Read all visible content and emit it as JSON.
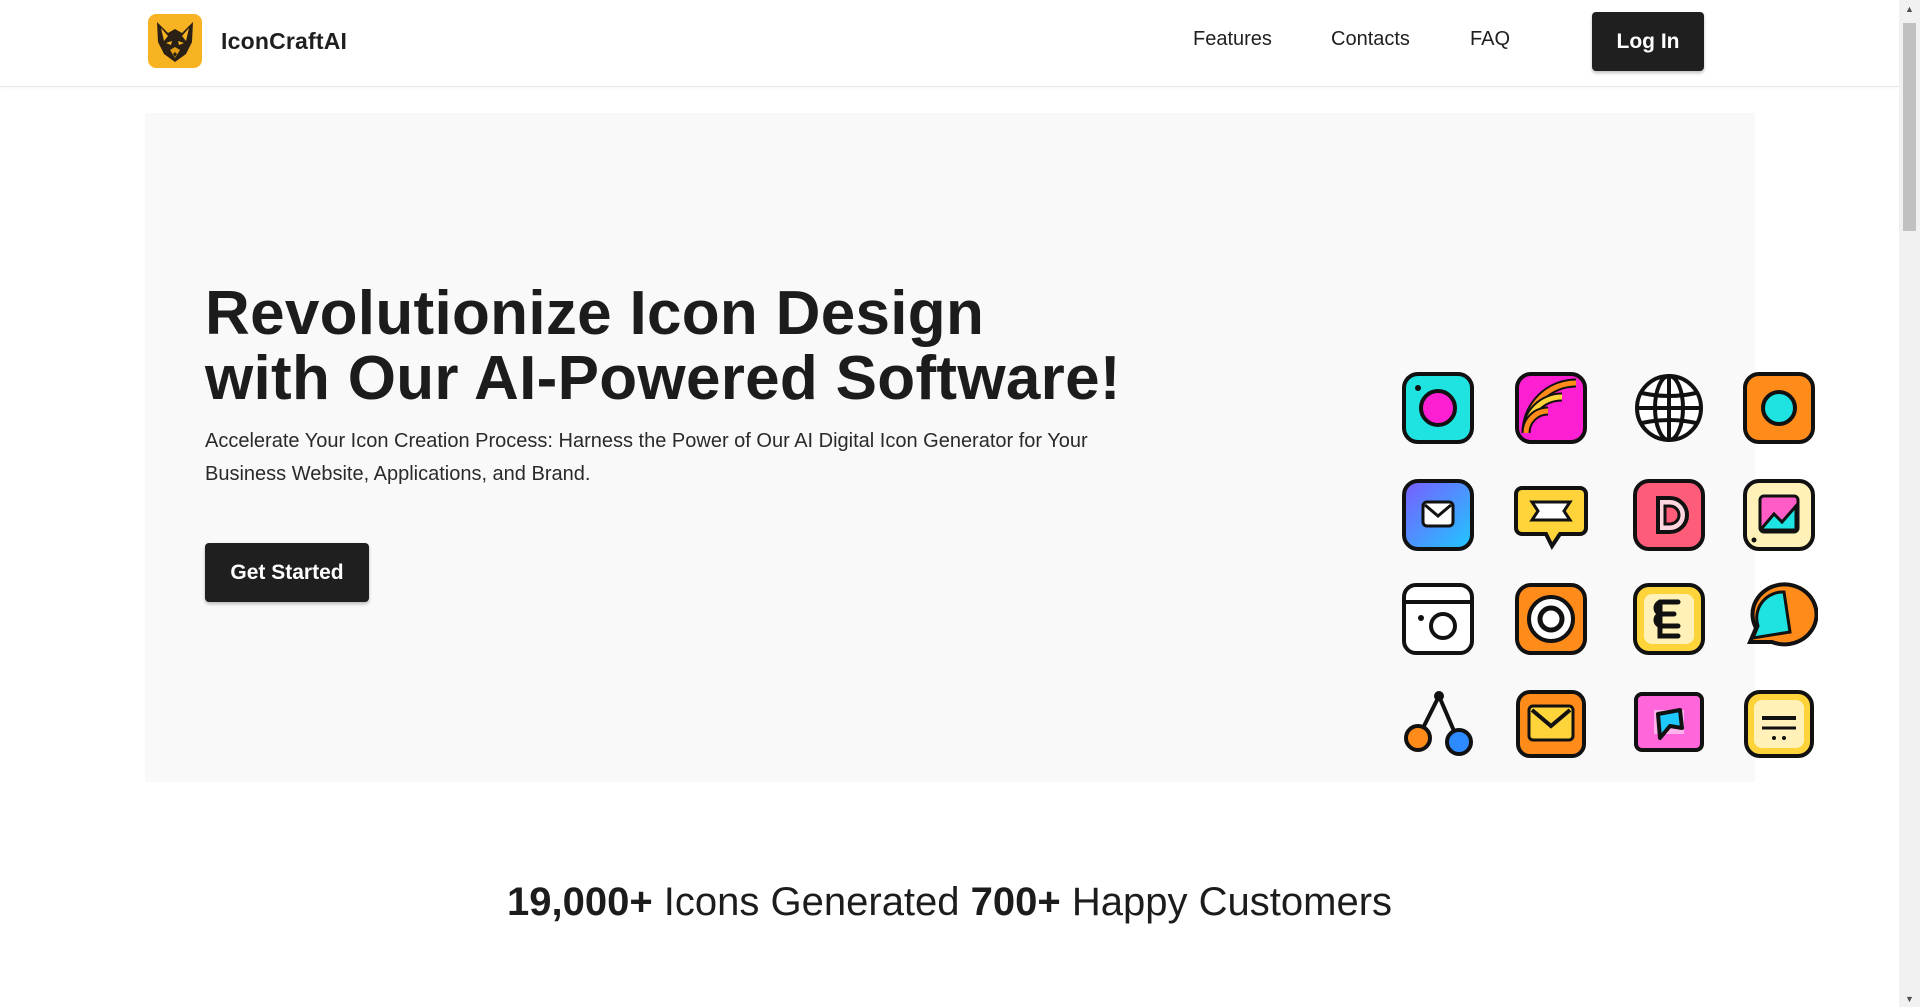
{
  "header": {
    "brand": "IconCraftAI",
    "logo_icon": "wolf-logo-icon",
    "nav": {
      "features": "Features",
      "contacts": "Contacts",
      "faq": "FAQ"
    },
    "login_label": "Log In"
  },
  "hero": {
    "title": "Revolutionize Icon Design with Our AI-Powered Software!",
    "subtitle": "Accelerate Your Icon Creation Process: Harness the Power of Our AI Digital Icon Generator for Your Business Website, Applications, and Brand.",
    "cta_label": "Get Started",
    "icons": [
      "camera-icon",
      "rss-icon",
      "globe-icon",
      "record-icon",
      "mail-icon",
      "chat-icon",
      "d-app-icon",
      "image-icon",
      "camera-outline-icon",
      "target-icon",
      "e-app-icon",
      "speech-bubble-icon",
      "share-nodes-icon",
      "envelope-icon",
      "photo-frame-icon",
      "card-icon"
    ]
  },
  "stats": {
    "icons_count": "19,000+",
    "icons_label": "Icons Generated",
    "customers_count": "700+",
    "customers_label": "Happy Customers"
  },
  "colors": {
    "dark": "#1f1f1f",
    "hero_bg": "#f9f9f9",
    "cyan": "#1fe3e0",
    "magenta": "#ff1fd2",
    "orange": "#ff8c1a",
    "yellow": "#ffd43b",
    "blue": "#2e8bff",
    "pink": "#ff5c7a",
    "cream": "#fff1b8"
  }
}
